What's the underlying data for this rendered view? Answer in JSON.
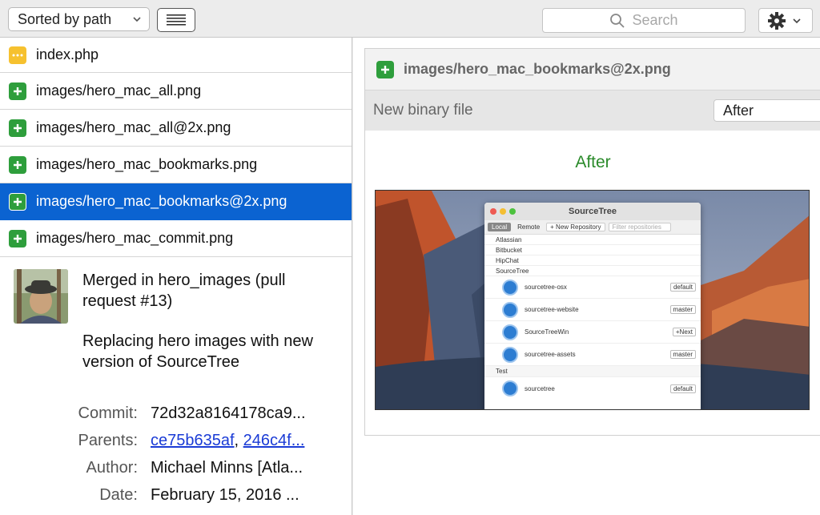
{
  "toolbar": {
    "sort_label": "Sorted by path",
    "search_placeholder": "Search"
  },
  "files": [
    {
      "name": "index.php",
      "status": "modified",
      "selected": false
    },
    {
      "name": "images/hero_mac_all.png",
      "status": "added",
      "selected": false
    },
    {
      "name": "images/hero_mac_all@2x.png",
      "status": "added",
      "selected": false
    },
    {
      "name": "images/hero_mac_bookmarks.png",
      "status": "added",
      "selected": false
    },
    {
      "name": "images/hero_mac_bookmarks@2x.png",
      "status": "added",
      "selected": true
    },
    {
      "name": "images/hero_mac_commit.png",
      "status": "added",
      "selected": false
    }
  ],
  "commit": {
    "title": "Merged in hero_images (pull request #13)",
    "body": "Replacing hero images with new version of SourceTree",
    "labels": {
      "commit": "Commit:",
      "parents": "Parents:",
      "author": "Author:",
      "date": "Date:"
    },
    "hash": "72d32a8164178ca9...",
    "parent1": "ce75b635af",
    "parent_sep": ", ",
    "parent2": "246c4f...",
    "author": "Michael Minns [Atla...",
    "date": "February 15, 2016 ..."
  },
  "diff": {
    "filename": "images/hero_mac_bookmarks@2x.png",
    "subtitle": "New binary file",
    "view_option": "After",
    "image_caption": "After"
  },
  "preview_app": {
    "title": "SourceTree",
    "tabs": [
      "Local",
      "Remote"
    ],
    "new_repo": "+ New Repository",
    "filter": "Filter repositories",
    "groups": [
      "Atlassian",
      "Bitbucket",
      "HipChat",
      "SourceTree"
    ],
    "repos": [
      {
        "name": "sourcetree-osx",
        "branch": "default"
      },
      {
        "name": "sourcetree-website",
        "branch": "master"
      },
      {
        "name": "SourceTreeWin",
        "branch": "+Next"
      },
      {
        "name": "sourcetree-assets",
        "branch": "master"
      }
    ],
    "group2": "Test",
    "repo_last": {
      "name": "sourcetree",
      "branch": "default"
    }
  },
  "colors": {
    "selection": "#0b63d1",
    "added": "#2e9e3c",
    "modified": "#f6c12f",
    "after_green": "#2a8a2a",
    "link": "#1a3bd6"
  }
}
